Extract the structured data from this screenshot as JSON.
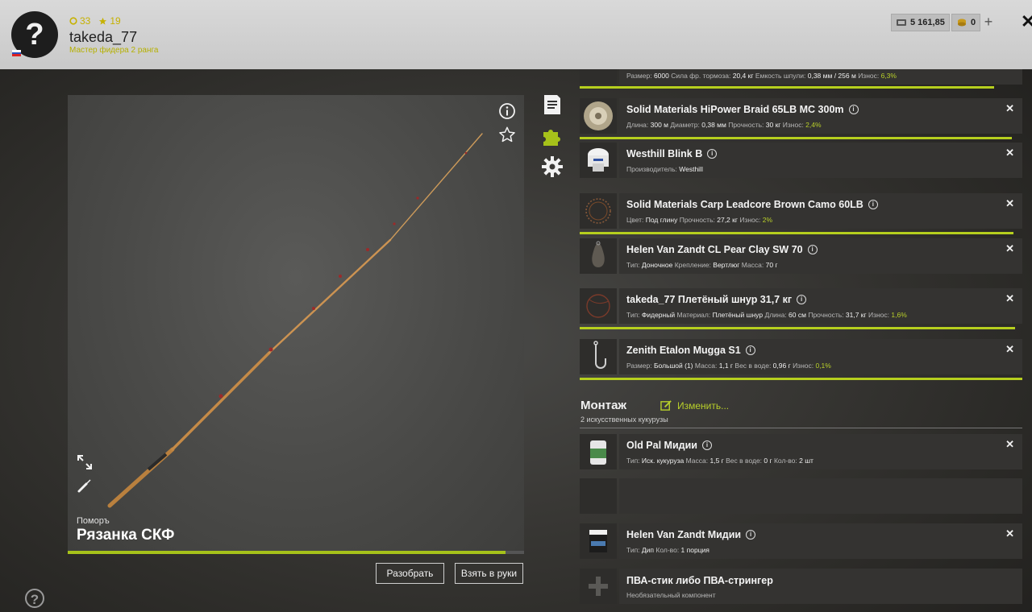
{
  "player": {
    "avatar_glyph": "?",
    "coins": "33",
    "stars": "19",
    "username": "takeda_77",
    "rank": "Мастер фидера 2 ранга"
  },
  "currency": {
    "silver": "5 161,85",
    "gold": "0",
    "plus": "+"
  },
  "rod": {
    "maker": "Поморъ",
    "name": "Рязанка СКФ",
    "durability_fraction": 0.96,
    "disassemble_label": "Разобрать",
    "take_label": "Взять в руки"
  },
  "tackle": [
    {
      "title": "",
      "props": [
        [
          "Размер:",
          "6000"
        ],
        [
          "Сила фр. тормоза:",
          "20,4 кг"
        ],
        [
          "Емкость шпули:",
          "0,38 мм / 256 м"
        ]
      ],
      "wear_label": "Износ:",
      "wear": "6,3%"
    },
    {
      "title": "Solid Materials HiPower Braid 65LB MC 300m",
      "props": [
        [
          "Длина:",
          "300 м"
        ],
        [
          "Диаметр:",
          "0,38 мм"
        ],
        [
          "Прочность:",
          "30 кг"
        ]
      ],
      "wear_label": "Износ:",
      "wear": "2,4%"
    },
    {
      "title": "Westhill Blink B",
      "props": [
        [
          "Производитель:",
          "Westhill"
        ]
      ],
      "wear_label": "",
      "wear": ""
    },
    {
      "title": "Solid Materials Carp Leadcore Brown Camo 60LB",
      "props": [
        [
          "Цвет:",
          "Под глину"
        ],
        [
          "Прочность:",
          "27,2 кг"
        ]
      ],
      "wear_label": "Износ:",
      "wear": "2%"
    },
    {
      "title": "Helen Van Zandt CL Pear Clay SW 70",
      "props": [
        [
          "Тип:",
          "Доночное"
        ],
        [
          "Крепление:",
          "Вертлюг"
        ],
        [
          "Масса:",
          "70 г"
        ]
      ],
      "wear_label": "",
      "wear": ""
    },
    {
      "title": "takeda_77 Плетёный шнур 31,7 кг",
      "props": [
        [
          "Тип:",
          "Фидерный"
        ],
        [
          "Материал:",
          "Плетёный шнур"
        ],
        [
          "Длина:",
          "60 см"
        ],
        [
          "Прочность:",
          "31,7 кг"
        ]
      ],
      "wear_label": "Износ:",
      "wear": "1,6%"
    },
    {
      "title": "Zenith Etalon Mugga S1",
      "props": [
        [
          "Размер:",
          "Большой (1)"
        ],
        [
          "Масса:",
          "1,1 г"
        ],
        [
          "Вес в воде:",
          "0,96 г"
        ]
      ],
      "wear_label": "Износ:",
      "wear": "0,1%"
    }
  ],
  "rig": {
    "title": "Монтаж",
    "edit_label": "Изменить...",
    "subtitle": "2 искусственных кукурузы",
    "items": [
      {
        "title": "Old Pal Мидии",
        "props": [
          [
            "Тип:",
            "Иск. кукуруза"
          ],
          [
            "Масса:",
            "1,5 г"
          ],
          [
            "Вес в воде:",
            "0 г"
          ],
          [
            "Кол-во:",
            "2 шт"
          ]
        ]
      },
      {
        "title": "Helen Van Zandt Мидии",
        "props": [
          [
            "Тип:",
            "Дип"
          ],
          [
            "Кол-во:",
            "1 порция"
          ]
        ]
      },
      {
        "title": "ПВА-стик либо ПВА-стрингер",
        "note": "Необязательный компонент"
      }
    ]
  },
  "colors": {
    "accent": "#b6cf1e",
    "topbar": "#d0d0d0",
    "row": "#343331"
  }
}
